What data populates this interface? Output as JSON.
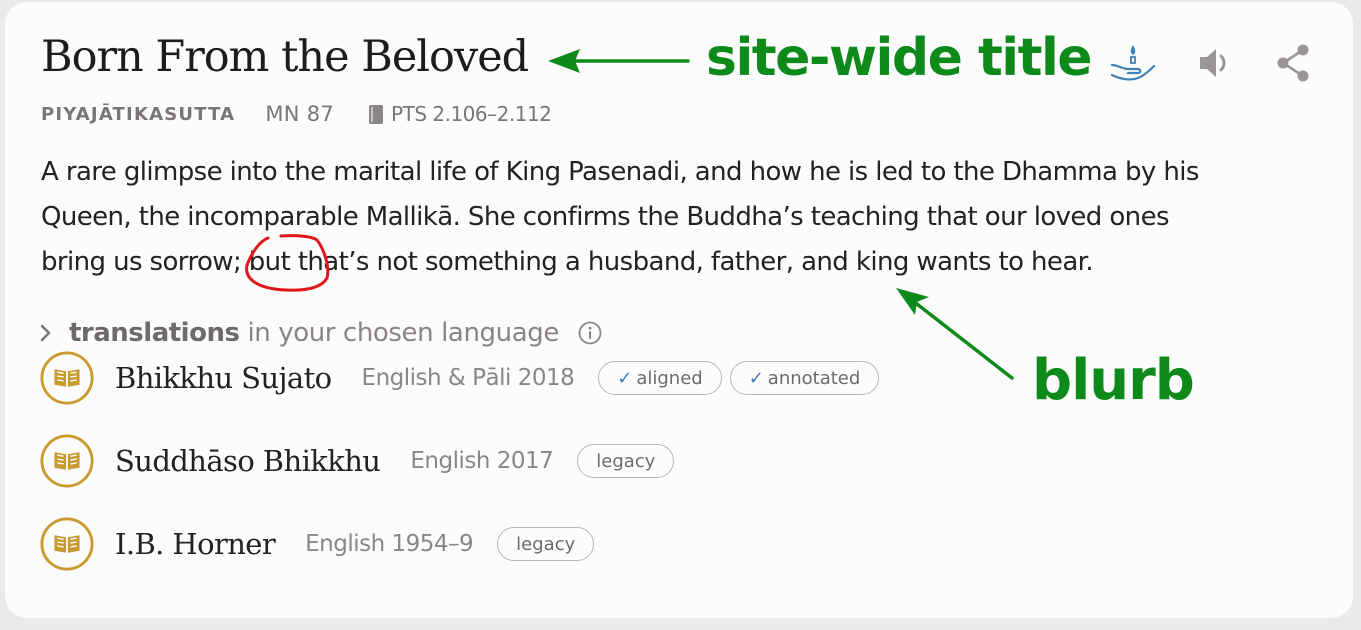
{
  "header": {
    "title": "Born From the Beloved",
    "uid": "PIYAJĀTIKASUTTA",
    "acronym": "MN 87",
    "pts_ref": "PTS 2.106–2.112"
  },
  "actions": [
    {
      "name": "offering-icon"
    },
    {
      "name": "speaker-icon"
    },
    {
      "name": "share-icon"
    }
  ],
  "blurb": {
    "line1": "A rare glimpse into the marital life of King Pasenadi, and how he is led to the Dhamma by his",
    "line2": "Queen, the incomparable Mallikā. She confirms the Buddha’s teaching that our loved ones",
    "line3_pre": "bring us sorrow",
    "line3_semicolon": ";",
    "line3_but": "but",
    "line3_post": " that’s not something a husband, father, and king wants to hear."
  },
  "translations": {
    "label_bold": "translations",
    "label_rest": "in your chosen language",
    "items": [
      {
        "author": "Bhikkhu Sujato",
        "lang": "English & Pāli 2018",
        "badges": [
          "aligned",
          "annotated"
        ],
        "check": "✓"
      },
      {
        "author": "Suddhāso Bhikkhu",
        "lang": "English 2017",
        "badges": [
          "legacy"
        ]
      },
      {
        "author": "I.B. Horner",
        "lang": "English 1954–9",
        "badges": [
          "legacy"
        ]
      }
    ]
  },
  "annotations": {
    "title_note": "site-wide title",
    "blurb_note": "blurb",
    "arrow_color": "#0e8a1a",
    "circle_color": "#e0161b"
  },
  "colors": {
    "gold": "#c99a2e",
    "icon_blue": "#3f82b8",
    "gray": "#7a7676"
  }
}
